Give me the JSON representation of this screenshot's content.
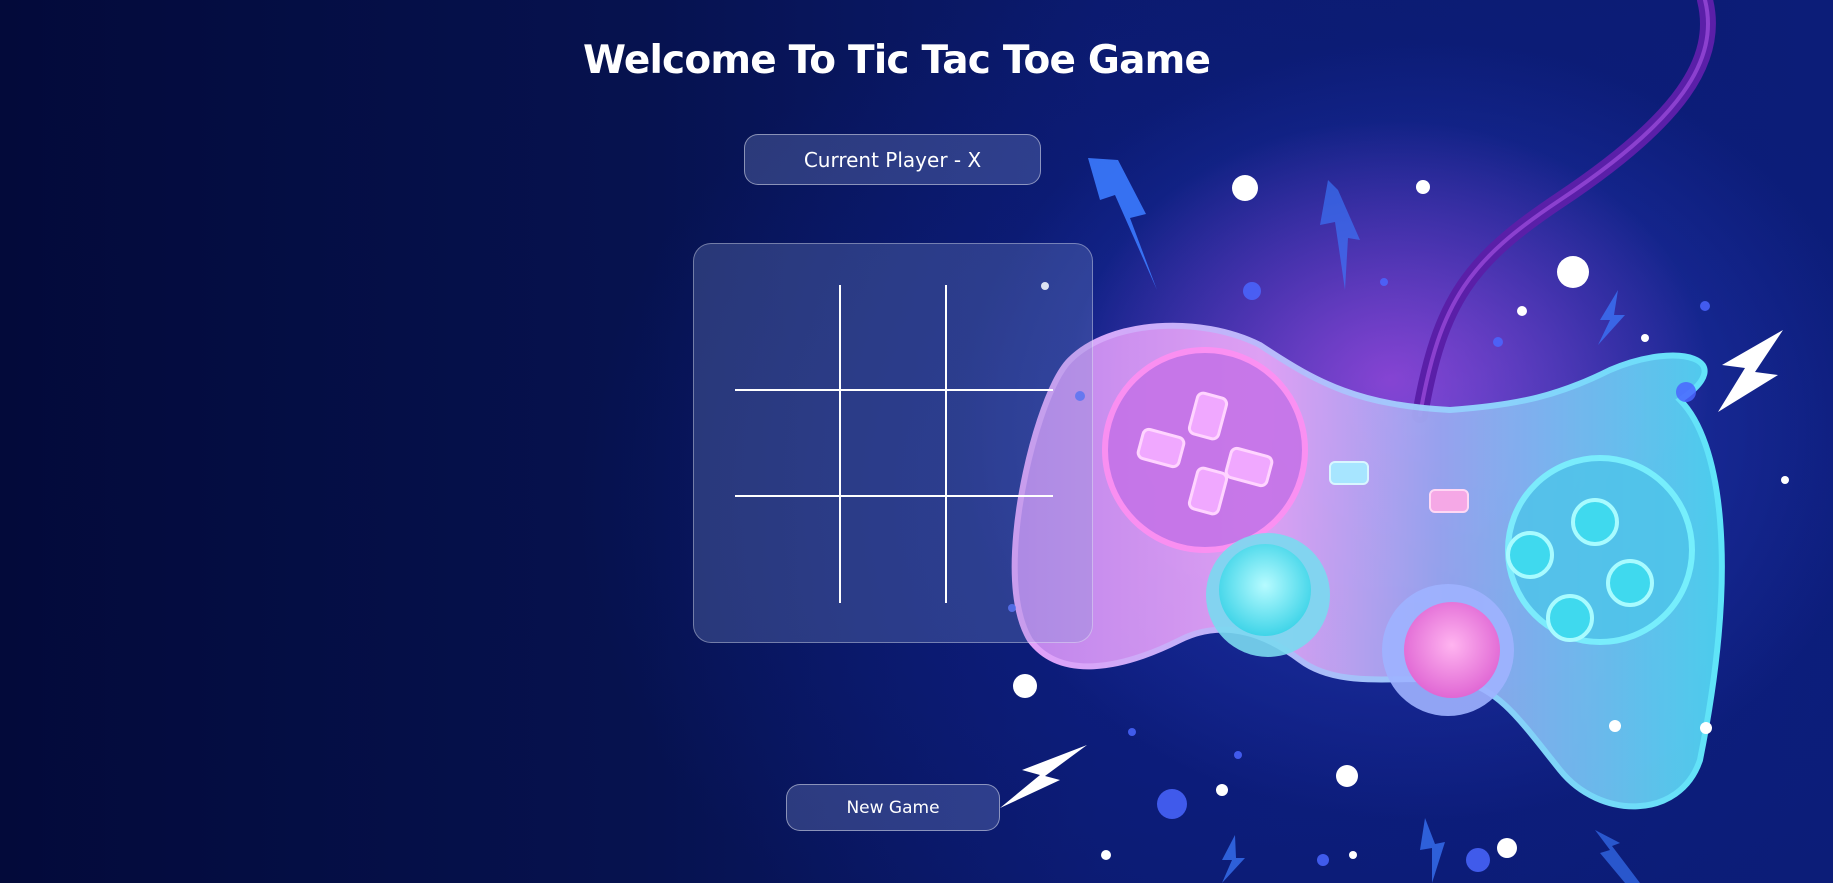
{
  "title": "Welcome To Tic Tac Toe Game",
  "status": "Current Player - X",
  "board": {
    "cells": [
      "",
      "",
      "",
      "",
      "",
      "",
      "",
      "",
      ""
    ]
  },
  "new_game_label": "New Game",
  "background": {
    "illustration": "gamepad-illustration",
    "colors": {
      "base": "#06124f",
      "neon_pink": "#e98cf5",
      "neon_cyan": "#4fe6f5"
    }
  }
}
